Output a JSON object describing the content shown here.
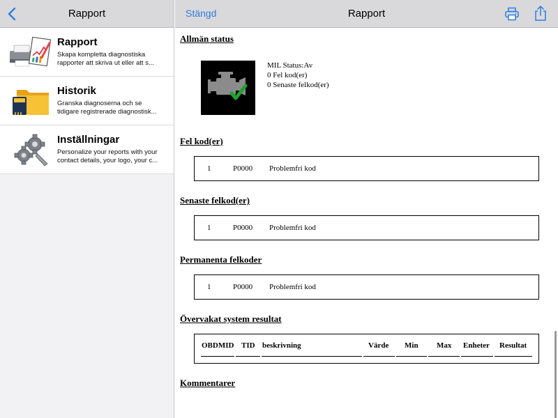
{
  "sidebar": {
    "title": "Rapport",
    "items": [
      {
        "title": "Rapport",
        "desc_line1": "Skapa kompletta diagnostiska",
        "desc_line2": "rapporter att skriva ut eller att s...",
        "icon": "printer-report-icon"
      },
      {
        "title": "Historik",
        "desc_line1": "Granska diagnoserna och se",
        "desc_line2": "tidigare registrerade diagnostisk...",
        "icon": "folder-history-icon"
      },
      {
        "title": "Inställningar",
        "desc_line1": "Personalize your reports with your",
        "desc_line2": "contact details, your logo, your c...",
        "icon": "settings-gears-icon"
      }
    ]
  },
  "detail": {
    "close_label": "Stängd",
    "title": "Rapport",
    "accent_color": "#2f7de1"
  },
  "report": {
    "general_status": {
      "heading": "Allmän status",
      "mil_status": "MIL Status:Av",
      "fault_codes_count": "0 Fel kod(er)",
      "recent_codes_count": "0 Senaste felkod(er)"
    },
    "fault_codes": {
      "heading": "Fel kod(er)",
      "rows": [
        {
          "num": "1",
          "code": "P0000",
          "desc": "Problemfri kod"
        }
      ]
    },
    "recent_codes": {
      "heading": "Senaste felkod(er)",
      "rows": [
        {
          "num": "1",
          "code": "P0000",
          "desc": "Problemfri kod"
        }
      ]
    },
    "permanent_codes": {
      "heading": "Permanenta felkoder",
      "rows": [
        {
          "num": "1",
          "code": "P0000",
          "desc": "Problemfri kod"
        }
      ]
    },
    "monitored_system": {
      "heading": "Övervakat system resultat",
      "columns": [
        "OBDMID",
        "TID",
        "beskrivning",
        "Värde",
        "Min",
        "Max",
        "Enheter",
        "Resultat"
      ]
    },
    "comments": {
      "heading": "Kommentarer"
    }
  }
}
